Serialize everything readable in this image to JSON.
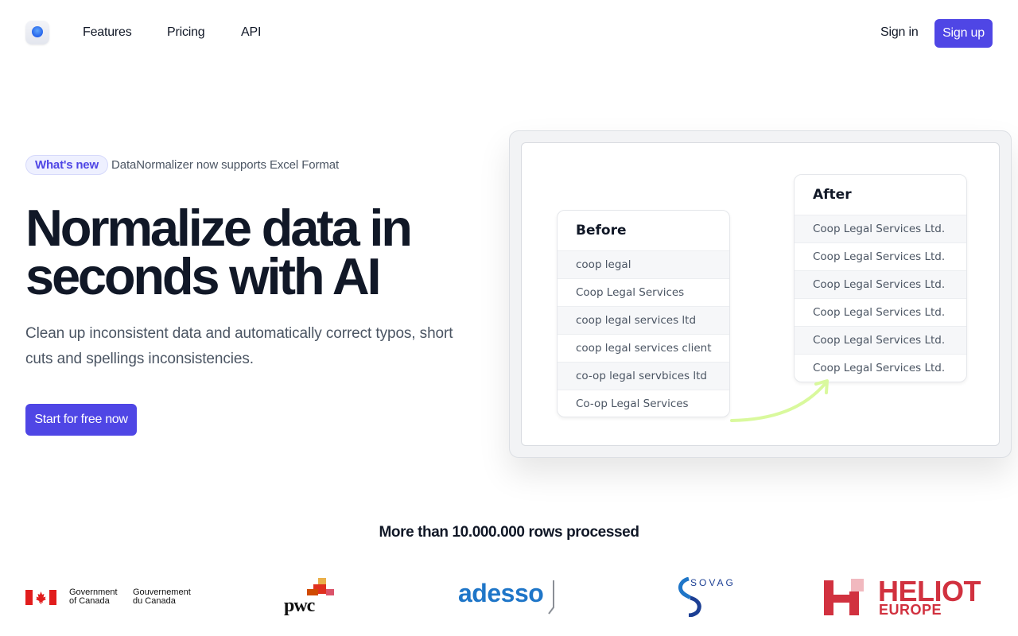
{
  "nav": {
    "links": [
      {
        "label": "Features"
      },
      {
        "label": "Pricing"
      },
      {
        "label": "API"
      }
    ],
    "sign_in": "Sign in",
    "sign_up": "Sign up"
  },
  "hero": {
    "badge": "What's new",
    "announcement": "DataNormalizer now supports Excel Format",
    "headline_line1": "Normalize data in",
    "headline_line2": "seconds with AI",
    "subtitle": "Clean up inconsistent data and automatically correct typos, short cuts and spellings inconsistencies.",
    "cta": "Start for free now"
  },
  "demo": {
    "before": {
      "title": "Before",
      "rows": [
        "coop legal",
        "Coop Legal Services",
        "coop legal services ltd",
        "coop legal services client",
        "co-op legal servbices ltd",
        "Co-op Legal Services"
      ]
    },
    "after": {
      "title": "After",
      "rows": [
        "Coop Legal Services Ltd.",
        "Coop Legal Services Ltd.",
        "Coop Legal Services Ltd.",
        "Coop Legal Services Ltd.",
        "Coop Legal Services Ltd.",
        "Coop Legal Services Ltd."
      ]
    },
    "arrow_color": "#d9f99d"
  },
  "stats": {
    "rows_processed": "More than 10.000.000 rows processed"
  },
  "logos": {
    "government": {
      "en_line1": "Government",
      "en_line2": "of Canada",
      "fr_line1": "Gouvernement",
      "fr_line2": "du Canada"
    },
    "pwc": "pwc",
    "adesso": "adesso",
    "sovag": "SOVAG",
    "heliot_name": "HELIOT",
    "heliot_sub": "EUROPE"
  },
  "colors": {
    "accent": "#4f46e5",
    "text": "#111827",
    "muted": "#4b5563",
    "heliot_red": "#d1313f",
    "adesso_blue": "#1f76c8"
  }
}
